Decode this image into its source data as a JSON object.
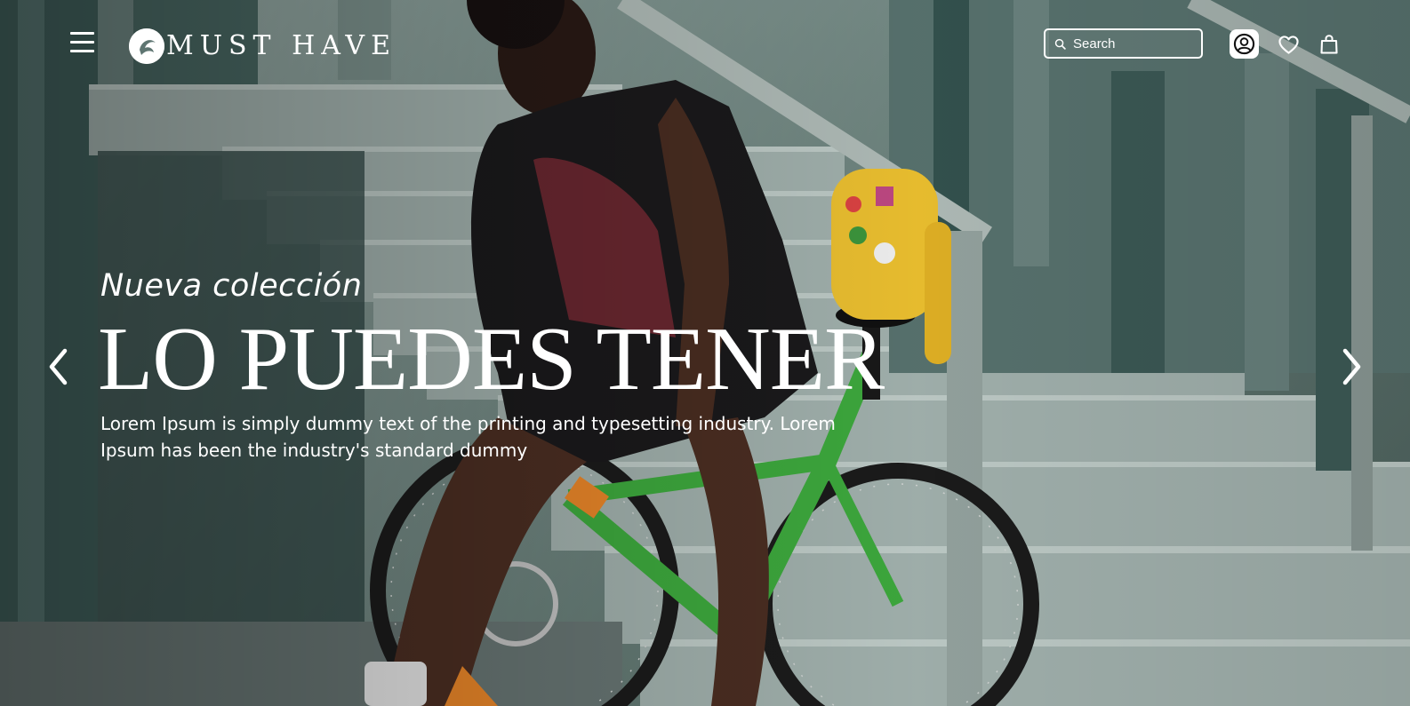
{
  "header": {
    "menu_icon": "hamburger-menu-icon",
    "logo_text": "MUST HAVE",
    "search": {
      "placeholder": "Search",
      "value": ""
    },
    "icons": [
      "account-icon",
      "heart-icon",
      "shopping-bag-icon"
    ]
  },
  "hero": {
    "kicker": "Nueva colección",
    "headline": "LO PUEDES TENER",
    "description": "Lorem Ipsum is simply dummy text of the printing and typesetting industry. Lorem Ipsum has been the industry's standard dummy",
    "nav_icons": [
      "chevron-left-icon",
      "chevron-right-icon"
    ]
  },
  "colors": {
    "text": "#ffffff",
    "bike_green": "#3fae3f",
    "backpack_yellow": "#f2c531"
  }
}
